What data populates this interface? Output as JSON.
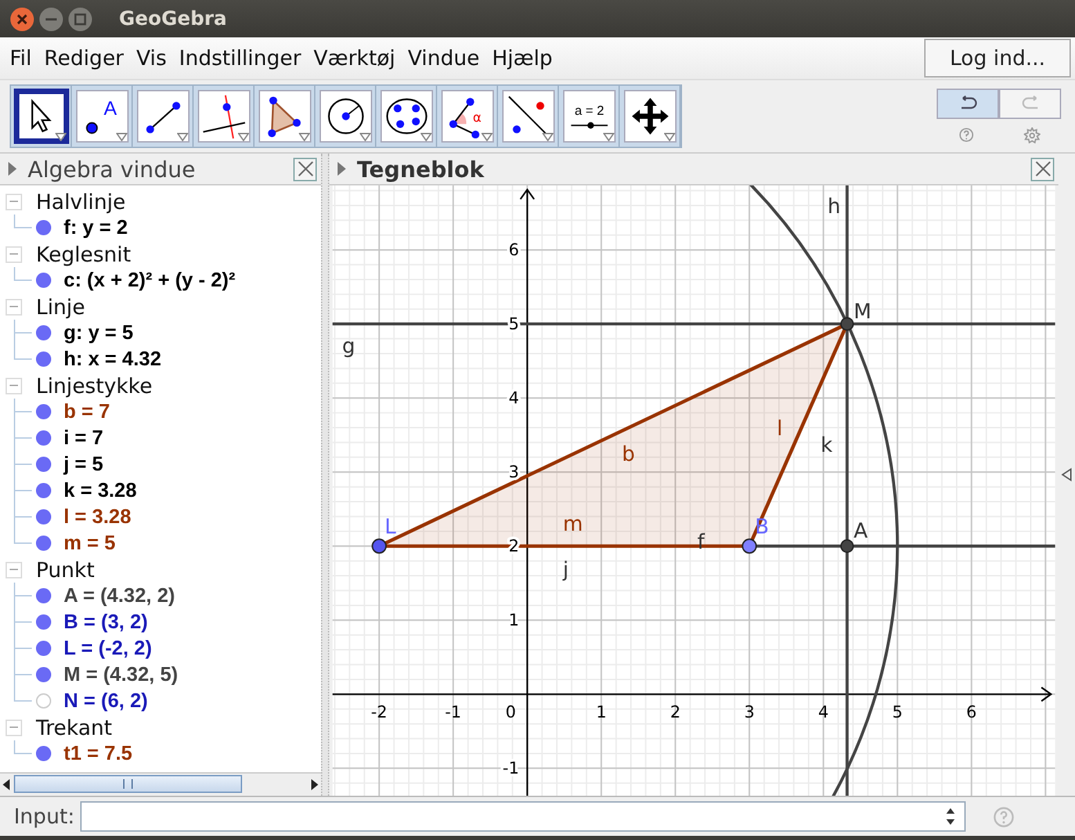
{
  "window": {
    "title": "GeoGebra"
  },
  "menu": [
    "Fil",
    "Rediger",
    "Vis",
    "Indstillinger",
    "Værktøj",
    "Vindue",
    "Hjælp"
  ],
  "login_button": "Log ind...",
  "tools": [
    {
      "kind": "move",
      "selected": true
    },
    {
      "kind": "point",
      "label": "A",
      "selected": false
    },
    {
      "kind": "segment",
      "selected": false
    },
    {
      "kind": "perpendicular",
      "selected": false
    },
    {
      "kind": "polygon",
      "selected": false
    },
    {
      "kind": "circle",
      "selected": false
    },
    {
      "kind": "conic",
      "selected": false
    },
    {
      "kind": "angle",
      "label": "α",
      "selected": false
    },
    {
      "kind": "reflect",
      "selected": false
    },
    {
      "kind": "slider",
      "label": "a = 2",
      "selected": false
    },
    {
      "kind": "pan",
      "selected": false
    }
  ],
  "undo": {
    "disabled": false
  },
  "redo": {
    "disabled": true
  },
  "algebra": {
    "title": "Algebra vindue",
    "groups": [
      {
        "name": "Halvlinje",
        "expanded": true,
        "children": [
          {
            "text": "f: y = 2",
            "color": "#000000",
            "visible": true
          }
        ]
      },
      {
        "name": "Keglesnit",
        "expanded": true,
        "children": [
          {
            "text": "c: (x + 2)² + (y - 2)²",
            "color": "#000000",
            "visible": true
          }
        ]
      },
      {
        "name": "Linje",
        "expanded": true,
        "children": [
          {
            "text": "g: y = 5",
            "color": "#000000",
            "visible": true
          },
          {
            "text": "h: x = 4.32",
            "color": "#000000",
            "visible": true
          }
        ]
      },
      {
        "name": "Linjestykke",
        "expanded": true,
        "children": [
          {
            "text": "b = 7",
            "color": "#993300",
            "visible": true
          },
          {
            "text": "i = 7",
            "color": "#000000",
            "visible": true
          },
          {
            "text": "j = 5",
            "color": "#000000",
            "visible": true
          },
          {
            "text": "k = 3.28",
            "color": "#000000",
            "visible": true
          },
          {
            "text": "l = 3.28",
            "color": "#993300",
            "visible": true
          },
          {
            "text": "m = 5",
            "color": "#993300",
            "visible": true
          }
        ]
      },
      {
        "name": "Punkt",
        "expanded": true,
        "children": [
          {
            "text": "A = (4.32, 2)",
            "color": "#444444",
            "visible": true
          },
          {
            "text": "B = (3, 2)",
            "color": "#1a1ab8",
            "visible": true
          },
          {
            "text": "L = (-2, 2)",
            "color": "#1a1ab8",
            "visible": true
          },
          {
            "text": "M = (4.32, 5)",
            "color": "#444444",
            "visible": true
          },
          {
            "text": "N = (6, 2)",
            "color": "#1a1ab8",
            "visible": false
          }
        ]
      },
      {
        "name": "Trekant",
        "expanded": true,
        "children": [
          {
            "text": "t1 = 7.5",
            "color": "#993300",
            "visible": true
          }
        ]
      }
    ]
  },
  "graphics": {
    "title": "Tegneblok",
    "xticks": [
      "-2",
      "-1",
      "0",
      "1",
      "2",
      "3",
      "4",
      "5",
      "6"
    ],
    "yticks": [
      "6",
      "5",
      "4",
      "3",
      "2",
      "1",
      "-1"
    ],
    "labels": [
      {
        "text": "h",
        "color": "#333333"
      },
      {
        "text": "g",
        "color": "#333333"
      },
      {
        "text": "M",
        "color": "#333333"
      },
      {
        "text": "b",
        "color": "#993300"
      },
      {
        "text": "l",
        "color": "#993300"
      },
      {
        "text": "k",
        "color": "#333333"
      },
      {
        "text": "L",
        "color": "#6666ff"
      },
      {
        "text": "m",
        "color": "#993300"
      },
      {
        "text": "B",
        "color": "#6666ff"
      },
      {
        "text": "f",
        "color": "#333333"
      },
      {
        "text": "A",
        "color": "#333333"
      },
      {
        "text": "j",
        "color": "#333333"
      }
    ]
  },
  "input": {
    "label": "Input:"
  }
}
